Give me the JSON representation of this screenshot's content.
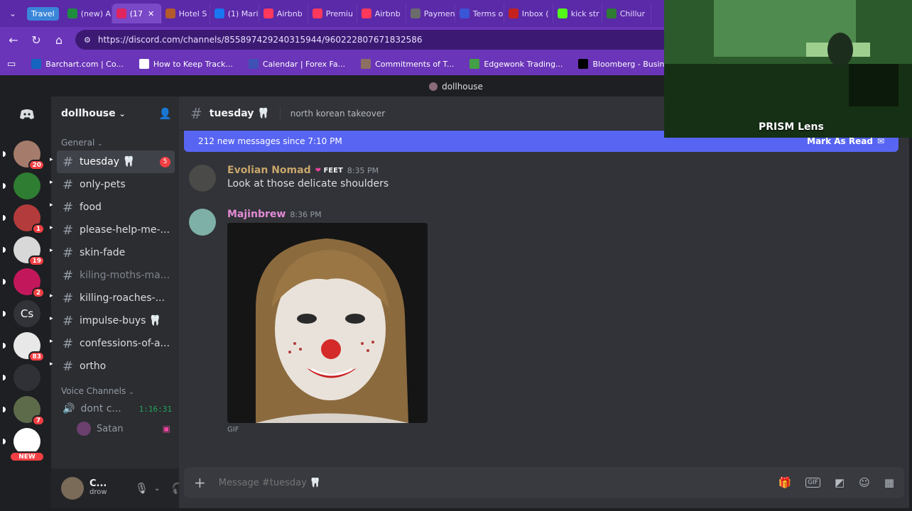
{
  "browser": {
    "tab_group": "Travel",
    "tabs": [
      {
        "label": "(new) A",
        "color": "#1e8e3e"
      },
      {
        "label": "(17",
        "color": "#e0245e",
        "active": true
      },
      {
        "label": "Hotel S",
        "color": "#b35a2a"
      },
      {
        "label": "(1) Mari",
        "color": "#1877f2"
      },
      {
        "label": "Airbnb",
        "color": "#ff385c"
      },
      {
        "label": "Premiu",
        "color": "#ff385c"
      },
      {
        "label": "Airbnb",
        "color": "#ff385c"
      },
      {
        "label": "Paymen",
        "color": "#6b6b6b"
      },
      {
        "label": "Terms o",
        "color": "#3a55d6"
      },
      {
        "label": "Inbox (",
        "color": "#c5221f"
      },
      {
        "label": "kick str",
        "color": "#53fc18"
      },
      {
        "label": "Chillur",
        "color": "#2e7d32"
      }
    ],
    "url": "https://discord.com/channels/855897429240315944/960222807671832586",
    "bookmarks": [
      {
        "label": "Barchart.com | Co...",
        "color": "#1565c0"
      },
      {
        "label": "How to Keep Track...",
        "color": "#ffffff"
      },
      {
        "label": "Calendar | Forex Fa...",
        "color": "#3f51b5"
      },
      {
        "label": "Commitments of T...",
        "color": "#8d6e63"
      },
      {
        "label": "Edgewonk Trading...",
        "color": "#43a047"
      },
      {
        "label": "Bloomberg - Busin...",
        "color": "#000000"
      }
    ]
  },
  "discord": {
    "window_title": "dollhouse",
    "server_name": "dollhouse",
    "servers": [
      {
        "label": "",
        "badge": "20",
        "color": "#a57c6b"
      },
      {
        "label": "",
        "badge": "",
        "color": "#2e7d32"
      },
      {
        "label": "",
        "badge": "1",
        "color": "#b43b3b"
      },
      {
        "label": "",
        "badge": "19",
        "color": "#d8d8d8"
      },
      {
        "label": "",
        "badge": "2",
        "color": "#c2185b"
      },
      {
        "label": "Cs",
        "badge": "",
        "color": "#313338"
      },
      {
        "label": "",
        "badge": "83",
        "color": "#e8e8e8"
      },
      {
        "label": "",
        "badge": "",
        "color": "#2f3136"
      },
      {
        "label": "",
        "badge": "7",
        "color": "#5d6b4a"
      },
      {
        "label": "",
        "badge": "NEW",
        "color": "#ffffff"
      }
    ],
    "categories": {
      "text": "General",
      "voice": "Voice Channels"
    },
    "channels": [
      {
        "name": "tuesday 🦷",
        "badge": "5",
        "selected": true
      },
      {
        "name": "only-pets"
      },
      {
        "name": "food"
      },
      {
        "name": "please-help-me-..."
      },
      {
        "name": "skin-fade"
      },
      {
        "name": "kiling-moths-ma...",
        "muted": true
      },
      {
        "name": "killing-roaches-..."
      },
      {
        "name": "impulse-buys 🦷"
      },
      {
        "name": "confessions-of-a..."
      },
      {
        "name": "ortho"
      }
    ],
    "voice_channel": {
      "name": "dont c...",
      "timer": "1:16:31",
      "member": "Satan"
    },
    "user": {
      "name": "C...",
      "status": "drow"
    },
    "channel_header": {
      "name": "tuesday 🦷",
      "topic": "north korean takeover"
    },
    "new_messages_bar": {
      "text": "212 new messages since 7:10 PM",
      "action": "Mark As Read"
    },
    "messages": [
      {
        "author": "Evolian Nomad",
        "author_color": "#c9a66b",
        "tag": "FEET",
        "time": "8:35 PM",
        "text": "Look at those delicate shoulders"
      },
      {
        "author": "Majinbrew",
        "author_color": "#e38bd6",
        "time": "8:36 PM",
        "attachment": "GIF"
      }
    ],
    "composer": {
      "placeholder": "Message #tuesday 🦷"
    }
  },
  "webcam": {
    "label": "PRISM Lens"
  }
}
